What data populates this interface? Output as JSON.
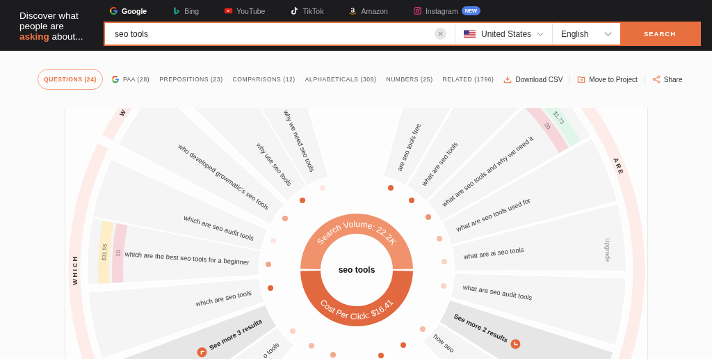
{
  "header": {
    "tagline": "Discover what people are **asking** about...",
    "engines": [
      {
        "label": "Google",
        "selected": true
      },
      {
        "label": "Bing",
        "selected": false
      },
      {
        "label": "YouTube",
        "selected": false
      },
      {
        "label": "TikTok",
        "selected": false
      },
      {
        "label": "Amazon",
        "selected": false
      },
      {
        "label": "Instagram",
        "selected": false,
        "badge": "NEW"
      }
    ],
    "search": {
      "value": "seo tools",
      "country": "United States",
      "language": "English",
      "button": "SEARCH"
    }
  },
  "tabs": [
    {
      "label": "QUESTIONS (24)",
      "selected": true,
      "kind": "plain"
    },
    {
      "label": "PAA (28)",
      "selected": false,
      "kind": "google"
    },
    {
      "label": "PREPOSITIONS (23)",
      "selected": false,
      "kind": "plain"
    },
    {
      "label": "COMPARISONS (12)",
      "selected": false,
      "kind": "plain"
    },
    {
      "label": "ALPHABETICALS (308)",
      "selected": false,
      "kind": "plain"
    },
    {
      "label": "NUMBERS (25)",
      "selected": false,
      "kind": "plain"
    },
    {
      "label": "RELATED (1796)",
      "selected": false,
      "kind": "plain"
    }
  ],
  "actions": [
    {
      "label": "Download CSV",
      "kind": "download"
    },
    {
      "label": "Move to Project",
      "kind": "folder"
    },
    {
      "label": "Share",
      "kind": "share"
    }
  ],
  "wheel": {
    "keyword": "seo tools",
    "search_volume": "Search Volume: 22.2K",
    "cost_per_click": "Cost Per Click: $16.41",
    "categories": [
      {
        "label": "WHICH"
      },
      {
        "label": "W"
      },
      {
        "label": "ARE"
      }
    ],
    "upgrade": "Upgrade",
    "left": [
      {
        "text": "why we need seo tools",
        "kind": "question"
      },
      {
        "text": "why use seo tools",
        "kind": "question"
      },
      {
        "text": "who developed growmatic's seo tools",
        "kind": "question"
      },
      {
        "text": "which are seo audit tools",
        "kind": "question"
      },
      {
        "text": "which are the best seo tools for a beginner",
        "kind": "question",
        "metrics": [
          {
            "text": "10",
            "color": "#f6d6da"
          },
          {
            "text": "$11.55",
            "color": "#fdeec8"
          }
        ]
      },
      {
        "text": "which are seo tools",
        "kind": "question"
      },
      {
        "text": "See more 3 results",
        "kind": "more"
      },
      {
        "text": "o tools",
        "kind": "question"
      }
    ],
    "right": [
      {
        "text": "are seo tools free",
        "kind": "question"
      },
      {
        "text": "what are seo tools",
        "kind": "question"
      },
      {
        "text": "what are seo tools and why we need it",
        "kind": "question",
        "metrics": [
          {
            "text": "20",
            "color": "#f6d6da"
          },
          {
            "text": "$1.73",
            "color": "#dff6ea"
          }
        ]
      },
      {
        "text": "what are seo tools used for",
        "kind": "question"
      },
      {
        "text": "what are ai seo tools",
        "kind": "question"
      },
      {
        "text": "what are seo audit tools",
        "kind": "question"
      },
      {
        "text": "See more 2 results",
        "kind": "more"
      },
      {
        "text": "how seo",
        "kind": "question"
      }
    ]
  }
}
